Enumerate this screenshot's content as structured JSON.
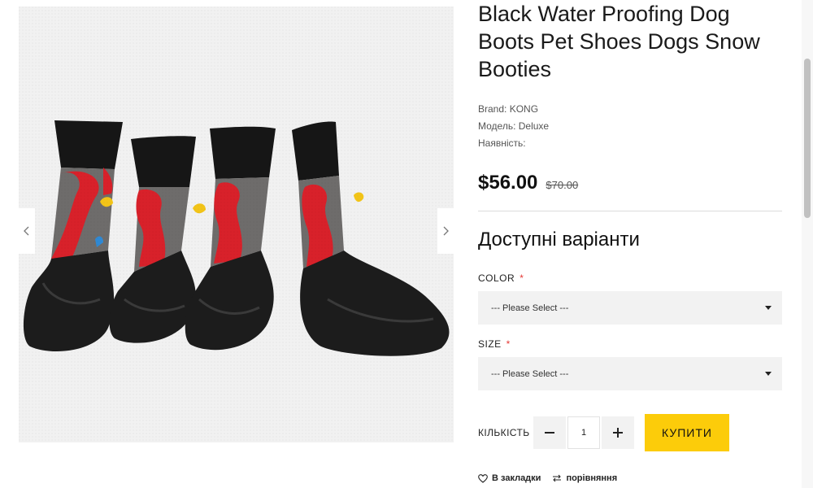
{
  "product": {
    "title": "Black Water Proofing Dog Boots Pet Shoes Dogs Snow Booties",
    "brand": "Brand: KONG",
    "model": "Модель: Deluxe",
    "availability": "Наявність:",
    "price": "$56.00",
    "old_price": "$70.00"
  },
  "variants": {
    "title": "Доступні варіанти",
    "color_label": "COLOR",
    "color_value": "--- Please Select ---",
    "size_label": "SIZE",
    "size_value": "--- Please Select ---",
    "required_mark": "*"
  },
  "purchase": {
    "qty_label": "КІЛЬКІСТЬ",
    "qty_value": "1",
    "buy_label": "КУПИТИ"
  },
  "links": {
    "wishlist": "В закладки",
    "compare": "порівняння"
  },
  "colors": {
    "accent": "#fccc0a",
    "required": "#e53935",
    "image_bg": "#f1f1f1",
    "sock_red": "#d8212a",
    "sock_grey": "#6e6c6b",
    "heart_yellow": "#f2c418"
  }
}
